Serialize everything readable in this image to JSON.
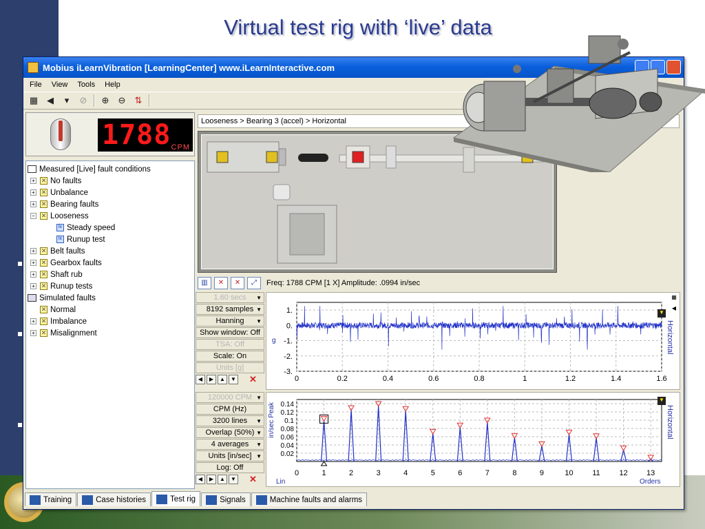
{
  "slide": {
    "title": "Virtual test rig with ‘live’ data"
  },
  "window": {
    "title": "Mobius iLearnVibration [LearningCenter]  www.iLearnInteractive.com"
  },
  "menu": [
    "File",
    "View",
    "Tools",
    "Help"
  ],
  "meter": {
    "value": "1788",
    "unit": "CPM"
  },
  "tree": [
    {
      "level": 0,
      "icon": "root",
      "label": "Measured [Live] fault conditions"
    },
    {
      "level": 1,
      "icon": "check",
      "label": "No faults"
    },
    {
      "level": 1,
      "icon": "check",
      "label": "Unbalance"
    },
    {
      "level": 1,
      "icon": "check",
      "label": "Bearing faults"
    },
    {
      "level": 1,
      "icon": "check",
      "label": "Looseness",
      "expanded": true
    },
    {
      "level": 2,
      "icon": "leaf",
      "label": "Steady speed"
    },
    {
      "level": 2,
      "icon": "leaf",
      "label": "Runup test"
    },
    {
      "level": 1,
      "icon": "check",
      "label": "Belt faults"
    },
    {
      "level": 1,
      "icon": "check",
      "label": "Gearbox faults"
    },
    {
      "level": 1,
      "icon": "check",
      "label": "Shaft rub"
    },
    {
      "level": 1,
      "icon": "check",
      "label": "Runup tests"
    },
    {
      "level": 0,
      "icon": "sim",
      "label": "Simulated faults"
    },
    {
      "level": 1,
      "icon": "check",
      "label": "Normal",
      "noexp": true
    },
    {
      "level": 1,
      "icon": "check",
      "label": "Imbalance"
    },
    {
      "level": 1,
      "icon": "check",
      "label": "Misalignment"
    }
  ],
  "breadcrumb": "Looseness > Bearing 3 (accel) > Horizontal",
  "freq_readout": "Freq: 1788 CPM  [1 X]  Amplitude: .0994 in/sec",
  "time_controls": [
    {
      "label": "1.60 secs",
      "dim": true,
      "dd": true
    },
    {
      "label": "8192 samples",
      "dim": false,
      "dd": true
    },
    {
      "label": "Hanning",
      "dim": false,
      "dd": true
    },
    {
      "label": "Show window: Off",
      "dim": false,
      "dd": false
    },
    {
      "label": "TSA: Off",
      "dim": true,
      "dd": false
    },
    {
      "label": "Scale: On",
      "dim": false,
      "dd": false
    },
    {
      "label": "Units [g]",
      "dim": true,
      "dd": false
    }
  ],
  "spec_controls": [
    {
      "label": "120000 CPM",
      "dim": true,
      "dd": true
    },
    {
      "label": "CPM (Hz)",
      "dim": false,
      "dd": false
    },
    {
      "label": "3200 lines",
      "dim": false,
      "dd": true
    },
    {
      "label": "Overlap (50%)",
      "dim": false,
      "dd": true
    },
    {
      "label": "4 averages",
      "dim": false,
      "dd": true
    },
    {
      "label": "Units [in/sec]",
      "dim": false,
      "dd": true
    },
    {
      "label": "Log: Off",
      "dim": false,
      "dd": false
    }
  ],
  "tabs": [
    {
      "label": "Training",
      "active": false
    },
    {
      "label": "Case histories",
      "active": false
    },
    {
      "label": "Test rig",
      "active": true
    },
    {
      "label": "Signals",
      "active": false
    },
    {
      "label": "Machine faults and alarms",
      "active": false
    }
  ],
  "chart_data": [
    {
      "type": "line",
      "title": "",
      "xlabel": "",
      "ylabel": "g",
      "side_label": "Horizontal",
      "xlim": [
        0,
        1.6
      ],
      "ylim": [
        -3,
        1.5
      ],
      "x_ticks": [
        "0",
        "0.2",
        "0.4",
        "0.6",
        "0.8",
        "1",
        "1.2",
        "1.4",
        "1.6"
      ],
      "y_ticks": [
        "1.",
        "0.",
        "-1.",
        "-2.",
        "-3."
      ],
      "series": [
        {
          "description": "waveform",
          "impulse_period_s": 0.0335,
          "baseline": 0.0,
          "noise_amplitude": 0.4,
          "impulse_min": -1.6,
          "impulse_max": 1.3
        }
      ]
    },
    {
      "type": "line",
      "title": "",
      "xlabel": "Orders",
      "x_scale_label": "Lin",
      "ylabel": "in/sec Peak",
      "side_label": "Horizontal",
      "xlim": [
        0,
        13.4
      ],
      "ylim": [
        0,
        0.15
      ],
      "x_ticks": [
        "0",
        "1",
        "2",
        "3",
        "4",
        "5",
        "6",
        "7",
        "8",
        "9",
        "10",
        "11",
        "12",
        "13"
      ],
      "y_ticks": [
        "0.14",
        "0.12",
        "0.1",
        "0.08",
        "0.06",
        "0.04",
        "0.02"
      ],
      "peaks": [
        {
          "order": 1,
          "value": 0.0994
        },
        {
          "order": 2,
          "value": 0.125
        },
        {
          "order": 3,
          "value": 0.135
        },
        {
          "order": 4,
          "value": 0.123
        },
        {
          "order": 5,
          "value": 0.068
        },
        {
          "order": 6,
          "value": 0.083
        },
        {
          "order": 7,
          "value": 0.095
        },
        {
          "order": 8,
          "value": 0.058
        },
        {
          "order": 9,
          "value": 0.038
        },
        {
          "order": 10,
          "value": 0.066
        },
        {
          "order": 11,
          "value": 0.057
        },
        {
          "order": 12,
          "value": 0.028
        },
        {
          "order": 13,
          "value": 0.005
        }
      ]
    }
  ],
  "colors": {
    "accent": "#0a5fdc",
    "trace": "#1f2fc8",
    "peak_marker": "#e23030",
    "led": "#ff1a1a"
  }
}
